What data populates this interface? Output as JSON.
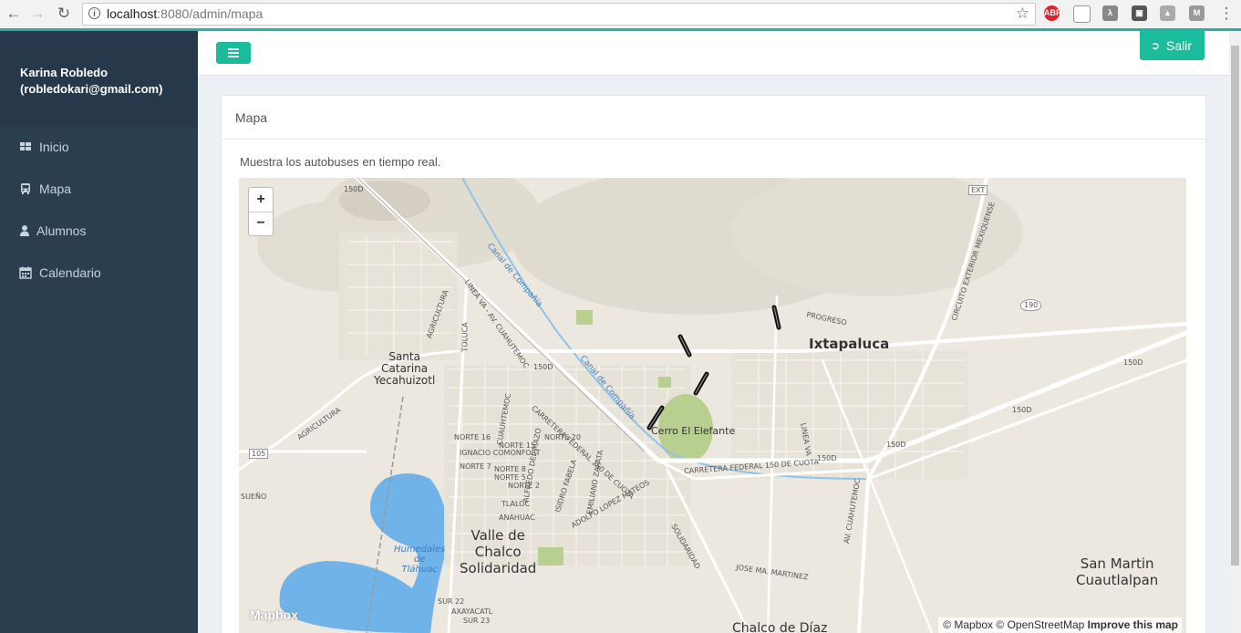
{
  "browser": {
    "url_host": "localhost",
    "url_rest": ":8080/admin/mapa",
    "extensions": [
      "ABP",
      "shield-ext",
      "lambda-ext",
      "save-ext",
      "drive-ext",
      "M"
    ]
  },
  "sidebar": {
    "user_name": "Karina Robledo",
    "user_email": "(robledokari@gmail.com)",
    "items": [
      {
        "label": "Inicio",
        "icon": "dashboard-icon"
      },
      {
        "label": "Mapa",
        "icon": "bus-icon"
      },
      {
        "label": "Alumnos",
        "icon": "user-icon"
      },
      {
        "label": "Calendario",
        "icon": "calendar-icon"
      }
    ]
  },
  "header": {
    "logout_label": "Salir"
  },
  "panel": {
    "title": "Mapa",
    "description": "Muestra los autobuses en tiempo real."
  },
  "map": {
    "zoom_in": "+",
    "zoom_out": "−",
    "logo": "Mapbox",
    "attribution_mapbox": "© Mapbox",
    "attribution_osm": "© OpenStreetMap",
    "attribution_improve": "Improve this map",
    "places": {
      "ixtapaluca": "Ixtapaluca",
      "santa_catarina": "Santa\nCatarina\nYecahuizotl",
      "cerro": "Cerro El Elefante",
      "valle_chalco": "Valle de\nChalco\nSolidaridad",
      "san_martin": "San Martin\nCuautlalpan",
      "chalco": "Chalco de Díaz",
      "humedales": "Humedales\nde\nTláhuac"
    },
    "roads": {
      "r150d_a": "150D",
      "r150d_b": "150D",
      "r150d_c": "150D",
      "r150d_d": "150D",
      "r150d_e": "150D",
      "r150d_f": "150D",
      "ext": "EXT",
      "r190": "190",
      "r105": "105",
      "progreso": "PROGRESO",
      "carretera": "CARRETERA FEDERAL 150 DE CUOTA",
      "carretera2": "CARRETERA FEDERAL 150 DE CUOTA",
      "canal": "Canal de Compañía",
      "canal2": "Canal de Compañía",
      "toluca": "TOLUCA",
      "agricultura": "AGRICULTURA",
      "agricultura2": "AGRICULTURA",
      "cuauhtemoc": "CUAUHTEMOC",
      "linea_va": "LINEA VA - AV. CUAHUTEMOC",
      "norte16": "NORTE 16",
      "norte15": "NORTE 15",
      "norte20": "NORTE 20",
      "ignacio": "IGNACIO COMONFORT",
      "norte7": "NORTE 7",
      "norte8": "NORTE 8",
      "norte5": "NORTE 5",
      "norte2": "NORTE 2",
      "tlaloc": "TLALOC",
      "anahuac": "ANAHUAC",
      "sur22": "SUR 22",
      "sur23": "SUR 23",
      "axayacatl": "AXAYACATL",
      "sueno": "SUEÑO",
      "adolfo": "ADOLFO LOPEZ MATEOS",
      "solidaridad": "SOLIDARIDAD",
      "jose_ma": "JOSE MA. MARTINEZ",
      "av_cuah": "AV. CUAHUTEMOC",
      "linea_va2": "LINEA VA",
      "circuito": "CIRCUITO EXTERIOR MEXIQUENSE",
      "isidro": "ISIDRO FABELA",
      "emiliano": "EMILIANO ZAPATA",
      "alfredo": "ALFREDO DEL MAZO"
    },
    "buses": 4
  },
  "colors": {
    "sidebar": "#2b3e50",
    "accent": "#1abc9c",
    "map_land": "#ece8df",
    "water": "#6fb3e8"
  }
}
